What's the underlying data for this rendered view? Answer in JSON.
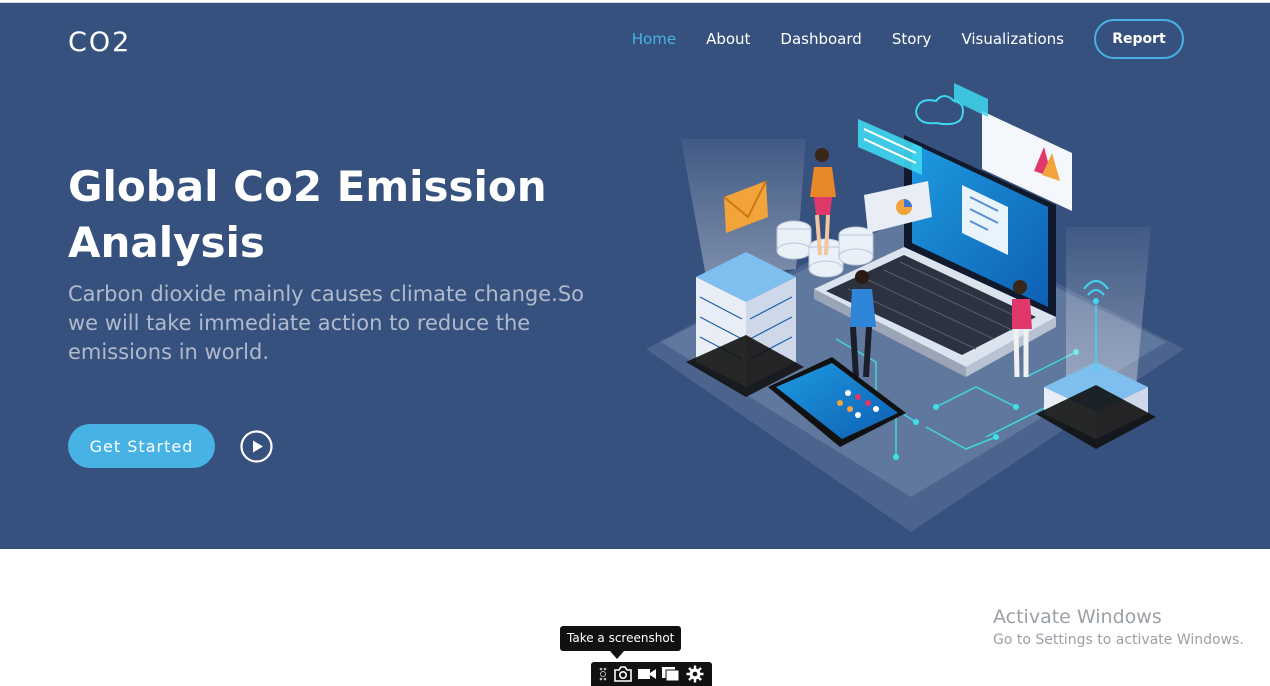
{
  "header": {
    "logo": "CO2",
    "nav": [
      {
        "label": "Home",
        "active": true
      },
      {
        "label": "About",
        "active": false
      },
      {
        "label": "Dashboard",
        "active": false
      },
      {
        "label": "Story",
        "active": false
      },
      {
        "label": "Visualizations",
        "active": false
      }
    ],
    "cta_label": "Report"
  },
  "hero": {
    "title": "Global Co2 Emission Analysis",
    "subtitle": "Carbon dioxide mainly causes climate change.So we will take immediate action to reduce the emissions in world.",
    "get_started_label": "Get Started",
    "play_icon": "play-circle-icon",
    "illustration": "isometric-data-analytics-illustration"
  },
  "os_overlay": {
    "activate_title": "Activate Windows",
    "activate_sub": "Go to Settings to activate Windows.",
    "tooltip": "Take a screenshot",
    "toolbar_icons": [
      "grip-icon",
      "camera-icon",
      "video-icon",
      "window-icon",
      "gear-icon"
    ]
  },
  "colors": {
    "hero_bg": "#37517e",
    "accent": "#47b2e4",
    "white": "#ffffff"
  }
}
